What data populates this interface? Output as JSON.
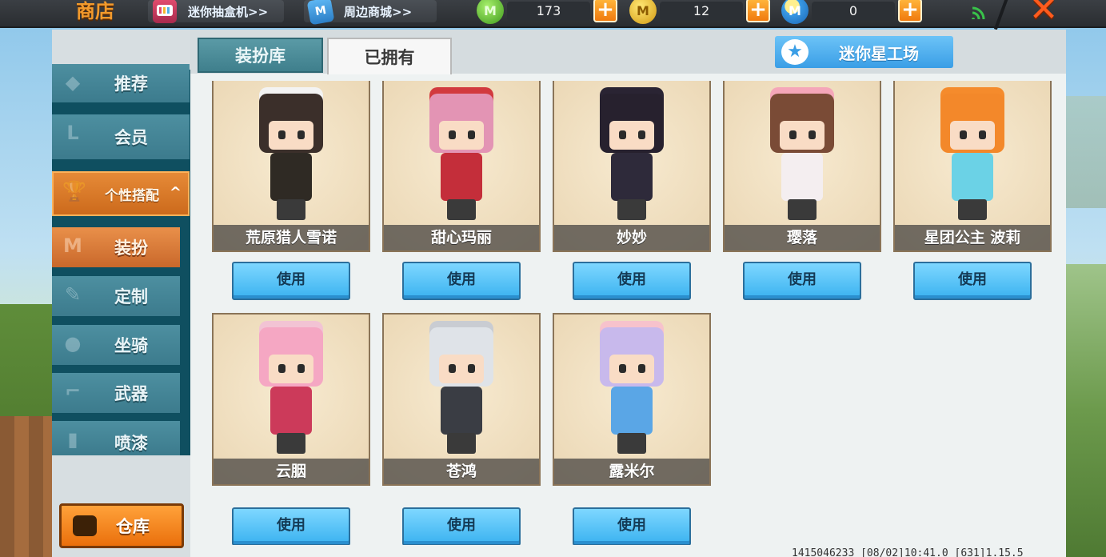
{
  "top_bar": {
    "title": "商店",
    "links": [
      {
        "label": "迷你抽盒机>>",
        "icon": "blind-box-icon"
      },
      {
        "label": "周边商城>>",
        "icon": "mall-icon"
      }
    ],
    "currencies": [
      {
        "name": "green-coin",
        "amount": "173",
        "icon": "green-coin-icon"
      },
      {
        "name": "gold-coin",
        "amount": "12",
        "icon": "gold-coin-icon"
      },
      {
        "name": "mini-coin",
        "amount": "0",
        "icon": "mini-coin-icon"
      }
    ],
    "plus_label": "+",
    "close_label": "✕"
  },
  "sidebar": {
    "items": [
      {
        "label": "推荐",
        "icon": "recommend-icon"
      },
      {
        "label": "会员",
        "icon": "member-icon"
      },
      {
        "label": "个性搭配",
        "icon": "trophy-icon",
        "expanded": true
      },
      {
        "label": "装扮",
        "icon": "shirt-icon",
        "active": true
      },
      {
        "label": "定制",
        "icon": "pencil-icon"
      },
      {
        "label": "坐骑",
        "icon": "mount-icon"
      },
      {
        "label": "武器",
        "icon": "gun-icon"
      },
      {
        "label": "喷漆",
        "icon": "spray-icon"
      }
    ],
    "group_toggle": "^",
    "warehouse_label": "仓库"
  },
  "main": {
    "tabs": [
      {
        "label": "装扮库",
        "active": false
      },
      {
        "label": "已拥有",
        "active": true
      }
    ],
    "workshop_label": "迷你星工场",
    "use_label": "使用",
    "skins": [
      {
        "name": "荒原猎人雪诺",
        "hair": "#3b2f2a",
        "outfit": "#2f2a24",
        "hood": "#f3f3f3"
      },
      {
        "name": "甜心玛丽",
        "hair": "#e394b4",
        "outfit": "#c42e3a",
        "hood": "#d23a3e"
      },
      {
        "name": "妙妙",
        "hair": "#27212e",
        "outfit": "#2e2a3a",
        "hood": "#2a2433"
      },
      {
        "name": "璎落",
        "hair": "#7a4b36",
        "outfit": "#f4eef0",
        "hood": "#f5a6b9"
      },
      {
        "name": "星团公主 波莉",
        "hair": "#f3882a",
        "outfit": "#6bd2e6",
        "hood": "#f58b2c"
      },
      {
        "name": "云胭",
        "hair": "#f5a7c3",
        "outfit": "#cc3a5a",
        "hood": "#f2c3d4"
      },
      {
        "name": "苍鸿",
        "hair": "#dfe3e8",
        "outfit": "#3a3d44",
        "hood": "#c9ccd2"
      },
      {
        "name": "露米尔",
        "hair": "#c8b9ec",
        "outfit": "#5aa6e6",
        "hood": "#f7c2cc"
      }
    ]
  },
  "debug": {
    "text": "1415046233   [08/02]10:41.0   [631]1.15.5"
  },
  "colors": {
    "accent_orange": "#f07a0e",
    "button_blue": "#3ab2f0",
    "teal": "#3f7f8c"
  }
}
